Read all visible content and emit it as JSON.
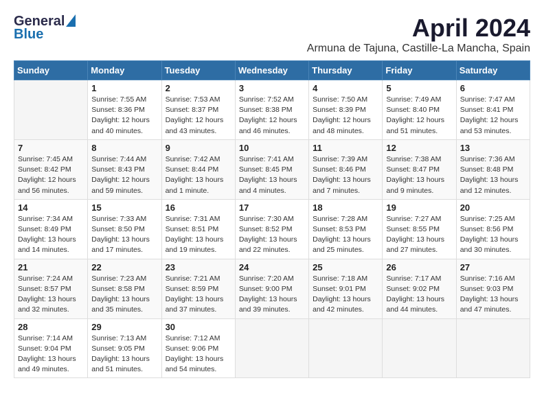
{
  "logo": {
    "general": "General",
    "blue": "Blue"
  },
  "header": {
    "month": "April 2024",
    "subtitle": "Armuna de Tajuna, Castille-La Mancha, Spain"
  },
  "weekdays": [
    "Sunday",
    "Monday",
    "Tuesday",
    "Wednesday",
    "Thursday",
    "Friday",
    "Saturday"
  ],
  "weeks": [
    [
      {
        "day": "",
        "sunrise": "",
        "sunset": "",
        "daylight": ""
      },
      {
        "day": "1",
        "sunrise": "Sunrise: 7:55 AM",
        "sunset": "Sunset: 8:36 PM",
        "daylight": "Daylight: 12 hours and 40 minutes."
      },
      {
        "day": "2",
        "sunrise": "Sunrise: 7:53 AM",
        "sunset": "Sunset: 8:37 PM",
        "daylight": "Daylight: 12 hours and 43 minutes."
      },
      {
        "day": "3",
        "sunrise": "Sunrise: 7:52 AM",
        "sunset": "Sunset: 8:38 PM",
        "daylight": "Daylight: 12 hours and 46 minutes."
      },
      {
        "day": "4",
        "sunrise": "Sunrise: 7:50 AM",
        "sunset": "Sunset: 8:39 PM",
        "daylight": "Daylight: 12 hours and 48 minutes."
      },
      {
        "day": "5",
        "sunrise": "Sunrise: 7:49 AM",
        "sunset": "Sunset: 8:40 PM",
        "daylight": "Daylight: 12 hours and 51 minutes."
      },
      {
        "day": "6",
        "sunrise": "Sunrise: 7:47 AM",
        "sunset": "Sunset: 8:41 PM",
        "daylight": "Daylight: 12 hours and 53 minutes."
      }
    ],
    [
      {
        "day": "7",
        "sunrise": "Sunrise: 7:45 AM",
        "sunset": "Sunset: 8:42 PM",
        "daylight": "Daylight: 12 hours and 56 minutes."
      },
      {
        "day": "8",
        "sunrise": "Sunrise: 7:44 AM",
        "sunset": "Sunset: 8:43 PM",
        "daylight": "Daylight: 12 hours and 59 minutes."
      },
      {
        "day": "9",
        "sunrise": "Sunrise: 7:42 AM",
        "sunset": "Sunset: 8:44 PM",
        "daylight": "Daylight: 13 hours and 1 minute."
      },
      {
        "day": "10",
        "sunrise": "Sunrise: 7:41 AM",
        "sunset": "Sunset: 8:45 PM",
        "daylight": "Daylight: 13 hours and 4 minutes."
      },
      {
        "day": "11",
        "sunrise": "Sunrise: 7:39 AM",
        "sunset": "Sunset: 8:46 PM",
        "daylight": "Daylight: 13 hours and 7 minutes."
      },
      {
        "day": "12",
        "sunrise": "Sunrise: 7:38 AM",
        "sunset": "Sunset: 8:47 PM",
        "daylight": "Daylight: 13 hours and 9 minutes."
      },
      {
        "day": "13",
        "sunrise": "Sunrise: 7:36 AM",
        "sunset": "Sunset: 8:48 PM",
        "daylight": "Daylight: 13 hours and 12 minutes."
      }
    ],
    [
      {
        "day": "14",
        "sunrise": "Sunrise: 7:34 AM",
        "sunset": "Sunset: 8:49 PM",
        "daylight": "Daylight: 13 hours and 14 minutes."
      },
      {
        "day": "15",
        "sunrise": "Sunrise: 7:33 AM",
        "sunset": "Sunset: 8:50 PM",
        "daylight": "Daylight: 13 hours and 17 minutes."
      },
      {
        "day": "16",
        "sunrise": "Sunrise: 7:31 AM",
        "sunset": "Sunset: 8:51 PM",
        "daylight": "Daylight: 13 hours and 19 minutes."
      },
      {
        "day": "17",
        "sunrise": "Sunrise: 7:30 AM",
        "sunset": "Sunset: 8:52 PM",
        "daylight": "Daylight: 13 hours and 22 minutes."
      },
      {
        "day": "18",
        "sunrise": "Sunrise: 7:28 AM",
        "sunset": "Sunset: 8:53 PM",
        "daylight": "Daylight: 13 hours and 25 minutes."
      },
      {
        "day": "19",
        "sunrise": "Sunrise: 7:27 AM",
        "sunset": "Sunset: 8:55 PM",
        "daylight": "Daylight: 13 hours and 27 minutes."
      },
      {
        "day": "20",
        "sunrise": "Sunrise: 7:25 AM",
        "sunset": "Sunset: 8:56 PM",
        "daylight": "Daylight: 13 hours and 30 minutes."
      }
    ],
    [
      {
        "day": "21",
        "sunrise": "Sunrise: 7:24 AM",
        "sunset": "Sunset: 8:57 PM",
        "daylight": "Daylight: 13 hours and 32 minutes."
      },
      {
        "day": "22",
        "sunrise": "Sunrise: 7:23 AM",
        "sunset": "Sunset: 8:58 PM",
        "daylight": "Daylight: 13 hours and 35 minutes."
      },
      {
        "day": "23",
        "sunrise": "Sunrise: 7:21 AM",
        "sunset": "Sunset: 8:59 PM",
        "daylight": "Daylight: 13 hours and 37 minutes."
      },
      {
        "day": "24",
        "sunrise": "Sunrise: 7:20 AM",
        "sunset": "Sunset: 9:00 PM",
        "daylight": "Daylight: 13 hours and 39 minutes."
      },
      {
        "day": "25",
        "sunrise": "Sunrise: 7:18 AM",
        "sunset": "Sunset: 9:01 PM",
        "daylight": "Daylight: 13 hours and 42 minutes."
      },
      {
        "day": "26",
        "sunrise": "Sunrise: 7:17 AM",
        "sunset": "Sunset: 9:02 PM",
        "daylight": "Daylight: 13 hours and 44 minutes."
      },
      {
        "day": "27",
        "sunrise": "Sunrise: 7:16 AM",
        "sunset": "Sunset: 9:03 PM",
        "daylight": "Daylight: 13 hours and 47 minutes."
      }
    ],
    [
      {
        "day": "28",
        "sunrise": "Sunrise: 7:14 AM",
        "sunset": "Sunset: 9:04 PM",
        "daylight": "Daylight: 13 hours and 49 minutes."
      },
      {
        "day": "29",
        "sunrise": "Sunrise: 7:13 AM",
        "sunset": "Sunset: 9:05 PM",
        "daylight": "Daylight: 13 hours and 51 minutes."
      },
      {
        "day": "30",
        "sunrise": "Sunrise: 7:12 AM",
        "sunset": "Sunset: 9:06 PM",
        "daylight": "Daylight: 13 hours and 54 minutes."
      },
      {
        "day": "",
        "sunrise": "",
        "sunset": "",
        "daylight": ""
      },
      {
        "day": "",
        "sunrise": "",
        "sunset": "",
        "daylight": ""
      },
      {
        "day": "",
        "sunrise": "",
        "sunset": "",
        "daylight": ""
      },
      {
        "day": "",
        "sunrise": "",
        "sunset": "",
        "daylight": ""
      }
    ]
  ]
}
